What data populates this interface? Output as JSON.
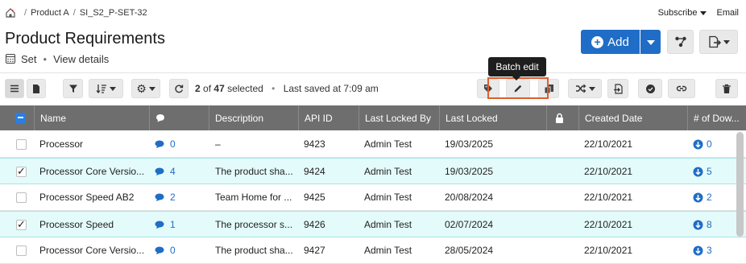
{
  "breadcrumb": {
    "items": [
      "Product A",
      "SI_S2_P-SET-32"
    ]
  },
  "top_links": {
    "subscribe": "Subscribe",
    "email": "Email"
  },
  "page": {
    "title": "Product Requirements",
    "set_label": "Set",
    "view_details": "View details"
  },
  "actions": {
    "add_label": "Add"
  },
  "toolbar": {
    "selected_count": "2",
    "selected_of": "of",
    "total_count": "47",
    "selected_word": "selected",
    "saved_text": "Last saved at 7:09 am",
    "tooltip": "Batch edit"
  },
  "table": {
    "columns": [
      "Name",
      "Description",
      "API ID",
      "Last Locked By",
      "Last Locked",
      "Created Date",
      "# of Dow..."
    ],
    "rows": [
      {
        "selected": false,
        "name": "Processor",
        "comments": "0",
        "description": "–",
        "api_id": "9423",
        "locked_by": "Admin Test",
        "last_locked": "19/03/2025",
        "created": "22/10/2021",
        "downstream": "0"
      },
      {
        "selected": true,
        "name": "Processor Core Versio...",
        "comments": "4",
        "description": "The product sha...",
        "api_id": "9424",
        "locked_by": "Admin Test",
        "last_locked": "19/03/2025",
        "created": "22/10/2021",
        "downstream": "5"
      },
      {
        "selected": false,
        "name": "Processor Speed AB2",
        "comments": "2",
        "description": "Team Home for ...",
        "api_id": "9425",
        "locked_by": "Admin Test",
        "last_locked": "20/08/2024",
        "created": "22/10/2021",
        "downstream": "2"
      },
      {
        "selected": true,
        "name": "Processor Speed",
        "comments": "1",
        "description": "The processor s...",
        "api_id": "9426",
        "locked_by": "Admin Test",
        "last_locked": "02/07/2024",
        "created": "22/10/2021",
        "downstream": "8"
      },
      {
        "selected": false,
        "name": "Processor Core Versio...",
        "comments": "0",
        "description": "The product sha...",
        "api_id": "9427",
        "locked_by": "Admin Test",
        "last_locked": "28/05/2024",
        "created": "22/10/2021",
        "downstream": "3"
      }
    ]
  },
  "colors": {
    "accent": "#1f6dc6",
    "header_bg": "#6e6e6e",
    "selected_row": "#e4fbfb",
    "highlight": "#e05e2e"
  }
}
